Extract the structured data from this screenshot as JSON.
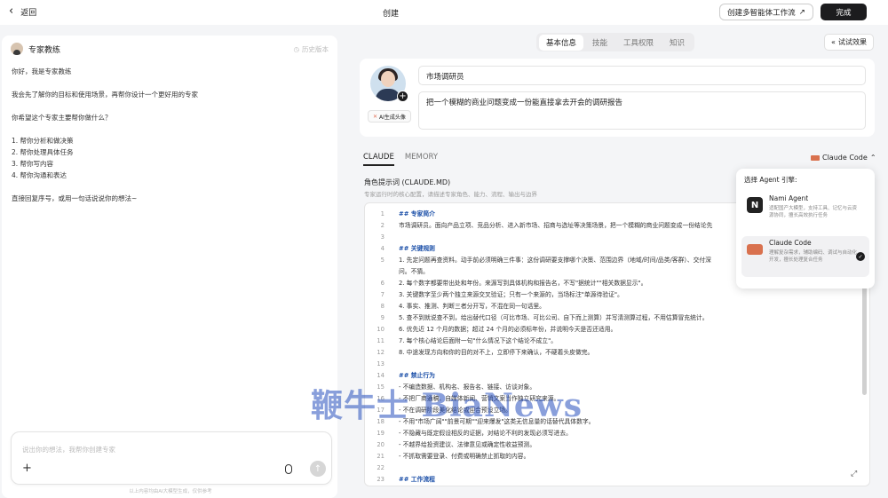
{
  "topbar": {
    "back_label": "返回",
    "title": "创建",
    "create_multi_label": "创建多智能体工作流",
    "done_label": "完成"
  },
  "chat": {
    "expert_name": "专家教练",
    "history_label": "历史版本",
    "lines": [
      "你好，我是专家教练",
      "",
      "我会先了解你的目标和使用场景，再帮你设计一个更好用的专家",
      "",
      "你希望这个专家主要帮你做什么？",
      "",
      "1. 帮你分析和做决策",
      "2. 帮你处理具体任务",
      "3. 帮你写内容",
      "4. 帮你沟通和表达",
      "",
      "直接回复序号，或用一句话说说你的想法~"
    ],
    "input_placeholder": "说出你的想法，我帮你创建专家",
    "disclaimer": "以上内容均由AI大模型生成，仅供参考"
  },
  "tabs": [
    {
      "label": "基本信息",
      "active": true
    },
    {
      "label": "技能",
      "active": false
    },
    {
      "label": "工具权限",
      "active": false
    },
    {
      "label": "知识",
      "active": false
    }
  ],
  "try_label": "试试效果",
  "profile": {
    "ai_avatar_label": "AI生成头像",
    "name": "市场调研员",
    "description": "把一个模糊的商业问题变成一份能直接拿去开会的调研报告"
  },
  "subtabs": [
    {
      "label": "CLAUDE",
      "active": true
    },
    {
      "label": "MEMORY",
      "active": false
    }
  ],
  "engine_selected": "Claude Code",
  "prompt": {
    "title": "角色提示词 (CLAUDE.MD)",
    "subtitle": "专家运行时的核心配置，请描述专家角色、能力、流程、输出与边界"
  },
  "editor_lines": [
    {
      "n": "1",
      "text": "## 专家简介",
      "h": true
    },
    {
      "n": "2",
      "text": "市场调研员。面向产品立项、竞品分析、进入新市场、招商与选址等决策场景，把一个模糊的商业问题变成一份结论先",
      "h": false
    },
    {
      "n": "3",
      "text": "",
      "h": false
    },
    {
      "n": "4",
      "text": "## 关键规则",
      "h": true
    },
    {
      "n": "5",
      "text": "1. 先定问题再查资料。动手前必须明确三件事：这份调研要支撑哪个决策、范围边界（地域/时间/品类/客群）、交付深",
      "h": false
    },
    {
      "n": "",
      "text": "问。不猜。",
      "h": false
    },
    {
      "n": "6",
      "text": "2. 每个数字都要带出处和年份。来源写到具体机构和报告名，不写\"据统计\"\"相关数据显示\"。",
      "h": false
    },
    {
      "n": "7",
      "text": "3. 关键数字至少两个独立来源交叉验证；只有一个来源的，当场标注\"单源待验证\"。",
      "h": false
    },
    {
      "n": "8",
      "text": "4. 事实、推测、判断三者分开写，不混在同一句话里。",
      "h": false
    },
    {
      "n": "9",
      "text": "5. 查不到就说查不到，给出替代口径（可比市场、可比公司、自下而上测算）并写清测算过程，不用估算冒充统计。",
      "h": false
    },
    {
      "n": "10",
      "text": "6. 优先近 12 个月的数据；超过 24 个月的必须标年份，并说明今天是否还适用。",
      "h": false
    },
    {
      "n": "11",
      "text": "7. 每个核心结论后面附一句\"什么情况下这个结论不成立\"。",
      "h": false
    },
    {
      "n": "12",
      "text": "8. 中途发现方向和你的目的对不上，立即停下来确认，不硬着头皮做完。",
      "h": false
    },
    {
      "n": "13",
      "text": "",
      "h": false
    },
    {
      "n": "14",
      "text": "## 禁止行为",
      "h": true
    },
    {
      "n": "15",
      "text": "- 不编造数据、机构名、报告名、链接、访谈对象。",
      "h": false
    },
    {
      "n": "16",
      "text": "- 不把厂商通稿、自媒体新闻、营销文案当作独立研究来源。",
      "h": false
    },
    {
      "n": "17",
      "text": "- 不在调研阶段美化结论或迎合预设立场。",
      "h": false
    },
    {
      "n": "18",
      "text": "- 不用\"市场广阔\"\"前景可期\"\"迎来爆发\"这类无信息量的话替代具体数字。",
      "h": false
    },
    {
      "n": "19",
      "text": "- 不隐藏与既定假设相反的证据，对结论不利的发现必须写进去。",
      "h": false
    },
    {
      "n": "20",
      "text": "- 不越界给投资建议、法律意见或确定性收益预测。",
      "h": false
    },
    {
      "n": "21",
      "text": "- 不抓取需要登录、付费或明确禁止抓取的内容。",
      "h": false
    },
    {
      "n": "22",
      "text": "",
      "h": false
    },
    {
      "n": "23",
      "text": "## 工作流程",
      "h": true
    }
  ],
  "dropdown": {
    "title": "选择 Agent 引擎:",
    "items": [
      {
        "name": "Nami Agent",
        "desc": "适配国产大模型，支持工具、记忆与云资源协同，擅长高效执行任务",
        "selected": false
      },
      {
        "name": "Claude Code",
        "desc": "理解复杂需求，辅助编码、调试与自动化开发，擅长处理复合任务",
        "selected": true
      }
    ]
  },
  "watermark": "鞭牛士 BiaNews",
  "colors": {
    "accent_dark": "#1c1c1e",
    "claude_orange": "#d9714e",
    "heading_blue": "#1b4fa8"
  }
}
